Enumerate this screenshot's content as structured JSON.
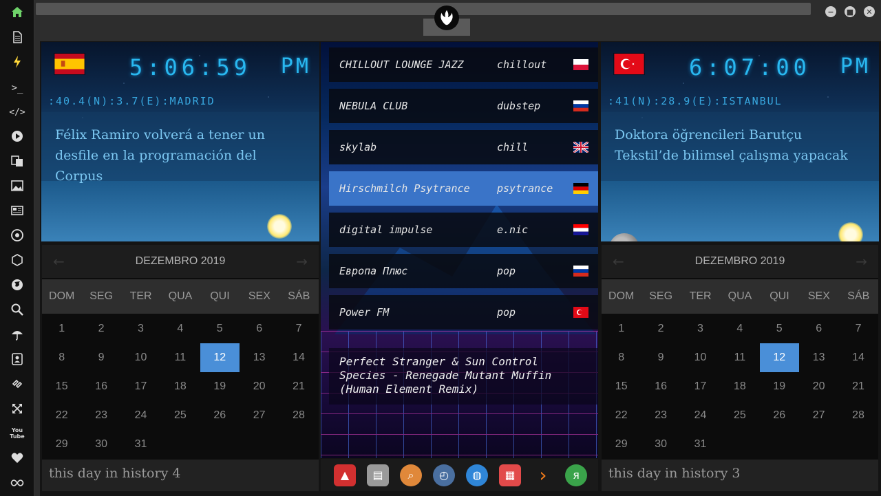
{
  "sidebar": {
    "items": [
      {
        "icon": "home-icon"
      },
      {
        "icon": "document-icon"
      },
      {
        "icon": "lightning-icon"
      },
      {
        "icon": "terminal-icon",
        "glyph": ">_"
      },
      {
        "icon": "code-icon",
        "glyph": "</>"
      },
      {
        "icon": "play-icon"
      },
      {
        "icon": "translate-icon"
      },
      {
        "icon": "image-icon"
      },
      {
        "icon": "newspaper-icon"
      },
      {
        "icon": "aperture-icon"
      },
      {
        "icon": "hexagon-icon"
      },
      {
        "icon": "globe-icon"
      },
      {
        "icon": "search-icon"
      },
      {
        "icon": "umbrella-icon"
      },
      {
        "icon": "contact-card-icon"
      },
      {
        "icon": "link-icon"
      },
      {
        "icon": "expand-icon"
      },
      {
        "icon": "youtube-icon",
        "glyph": "You\nTube"
      },
      {
        "icon": "heart-icon"
      },
      {
        "icon": "infinity-icon"
      }
    ]
  },
  "titlebar": {
    "logo": "rebel-alliance-icon",
    "buttons": [
      {
        "icon": "minimize-icon"
      },
      {
        "icon": "maximize-icon"
      },
      {
        "icon": "close-icon"
      }
    ]
  },
  "clocks": {
    "left": {
      "flag": "spain-flag",
      "time": "5:06:59",
      "ampm": "PM",
      "coords": ":40.4(N):3.7(E):MADRID",
      "headline": "Félix Ramiro volverá a tener un desfile en la programación del Corpus"
    },
    "right": {
      "flag": "turkey-flag",
      "time": "6:07:00",
      "ampm": "PM",
      "coords": ":41(N):28.9(E):ISTANBUL",
      "headline": "Doktora öğrencileri Barutçu Tekstil’de bilimsel çalışma yapacak"
    }
  },
  "calendars": {
    "left": {
      "title": "DEZEMBRO 2019",
      "dows": [
        "DOM",
        "SEG",
        "TER",
        "QUA",
        "QUI",
        "SEX",
        "SÁB"
      ],
      "days": [
        "1",
        "2",
        "3",
        "4",
        "5",
        "6",
        "7",
        "8",
        "9",
        "10",
        "11",
        "12",
        "13",
        "14",
        "15",
        "16",
        "17",
        "18",
        "19",
        "20",
        "21",
        "22",
        "23",
        "24",
        "25",
        "26",
        "27",
        "28",
        "29",
        "30",
        "31"
      ],
      "today": "12",
      "history": "this day in history 4"
    },
    "right": {
      "title": "DEZEMBRO 2019",
      "dows": [
        "DOM",
        "SEG",
        "TER",
        "QUA",
        "QUI",
        "SEX",
        "SÁB"
      ],
      "days": [
        "1",
        "2",
        "3",
        "4",
        "5",
        "6",
        "7",
        "8",
        "9",
        "10",
        "11",
        "12",
        "13",
        "14",
        "15",
        "16",
        "17",
        "18",
        "19",
        "20",
        "21",
        "22",
        "23",
        "24",
        "25",
        "26",
        "27",
        "28",
        "29",
        "30",
        "31"
      ],
      "today": "12",
      "history": "this day in history 3"
    }
  },
  "radio": {
    "stations": [
      {
        "name": "CHILLOUT LOUNGE JAZZ",
        "genre": "chillout",
        "flag": "poland-flag"
      },
      {
        "name": "NEBULA CLUB",
        "genre": "dubstep",
        "flag": "russia-flag"
      },
      {
        "name": "skylab",
        "genre": "chill",
        "flag": "uk-flag"
      },
      {
        "name": "Hirschmilch Psytrance",
        "genre": "psytrance",
        "flag": "germany-flag",
        "active": true
      },
      {
        "name": "digital impulse",
        "genre": "e.nic",
        "flag": "croatia-flag"
      },
      {
        "name": "Европа Плюс",
        "genre": "pop",
        "flag": "russia-flag"
      },
      {
        "name": "Power FM",
        "genre": "pop",
        "flag": "turkey-flag"
      }
    ],
    "now_playing": "Perfect Stranger & Sun Control\nSpecies - Renegade Mutant Muffin\n(Human Element Remix)"
  },
  "dock": {
    "icons": [
      {
        "name": "dock-app-red-icon",
        "color": "#d23030"
      },
      {
        "name": "dock-news-icon",
        "color": "#9a9a9a"
      },
      {
        "name": "dock-search-icon",
        "color": "#e0883a"
      },
      {
        "name": "dock-clock-icon",
        "color": "#4a6fa0"
      },
      {
        "name": "dock-browser-icon",
        "color": "#2f86d8"
      },
      {
        "name": "dock-calendar-icon",
        "color": "#e24a4a"
      },
      {
        "name": "dock-arrow-icon",
        "color": "#f07b1a"
      },
      {
        "name": "dock-yandex-icon",
        "color": "#3aa34a"
      }
    ]
  }
}
